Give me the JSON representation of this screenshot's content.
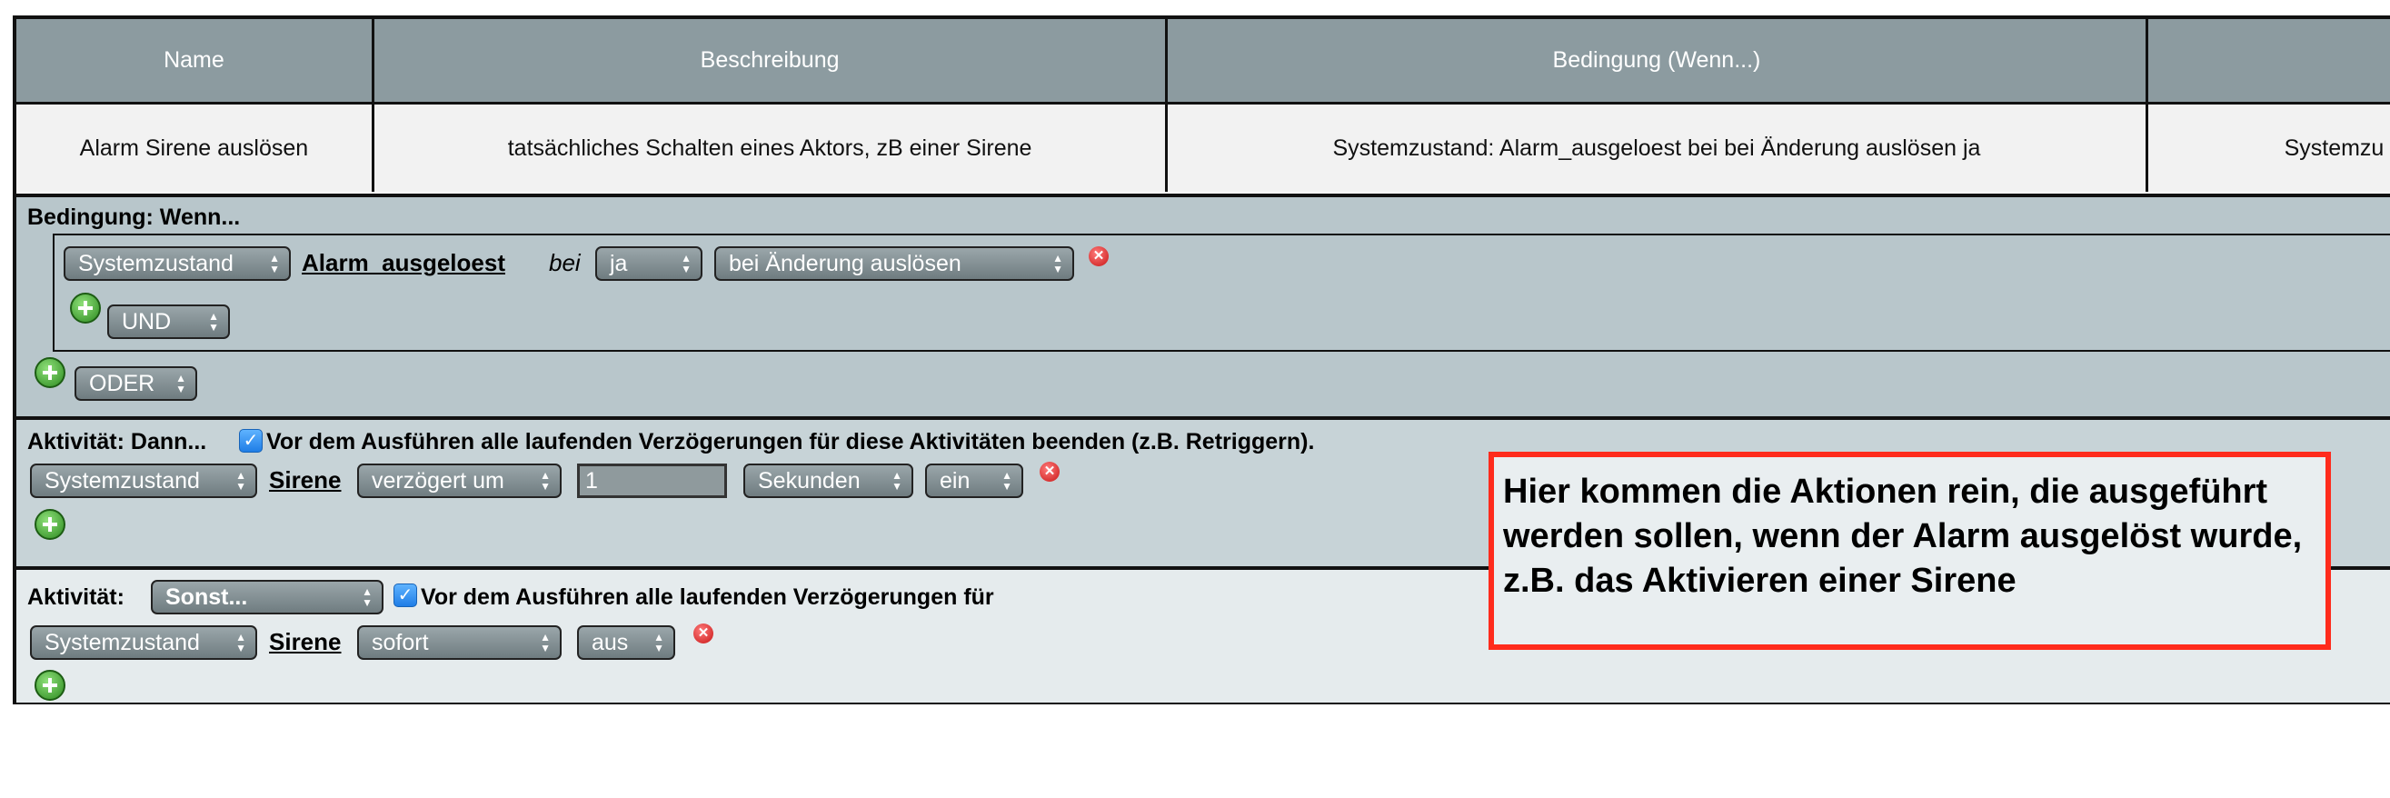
{
  "table": {
    "headers": [
      "Name",
      "Beschreibung",
      "Bedingung (Wenn...)",
      ""
    ],
    "row": [
      "Alarm Sirene auslösen",
      "tatsächliches Schalten eines Aktors, zB einer Sirene",
      "Systemzustand: Alarm_ausgeloest bei bei Änderung auslösen ja",
      "Systemzu"
    ]
  },
  "condition": {
    "label": "Bedingung: Wenn...",
    "source_select": "Systemzustand",
    "variable": "Alarm_ausgeloest",
    "bei_word": "bei",
    "value_select": "ja",
    "trigger_select": "bei Änderung auslösen",
    "and_select": "UND",
    "or_select": "ODER"
  },
  "then_activity": {
    "label": "Aktivität: Dann...",
    "checkbox_text": "Vor dem Ausführen alle laufenden Verzögerungen für diese Aktivitäten beenden (z.B. Retriggern).",
    "source_select": "Systemzustand",
    "target": "Sirene",
    "timing_select": "verzögert um",
    "delay_value": "1",
    "unit_select": "Sekunden",
    "state_select": "ein"
  },
  "else_activity": {
    "label": "Aktivität:",
    "mode_select": "Sonst...",
    "checkbox_text": "Vor dem Ausführen alle laufenden Verzögerungen für",
    "source_select": "Systemzustand",
    "target": "Sirene",
    "timing_select": "sofort",
    "state_select": "aus"
  },
  "annotation": {
    "text": "Hier kommen die Aktionen rein, die ausgeführt werden sollen, wenn der Alarm ausgelöst wurde, z.B. das Aktivieren einer Sirene",
    "border_color": "#ff2b1c"
  },
  "colors": {
    "header_bg": "#8c9ba0",
    "condition_bg": "#b8c6cb",
    "then_bg": "#c7d3d7",
    "else_bg": "#e5ebed"
  },
  "icons": {
    "add": "plus-icon",
    "delete": "delete-icon",
    "checkbox": "checkbox-checked-icon",
    "select_arrow": "updown-arrow-icon"
  }
}
